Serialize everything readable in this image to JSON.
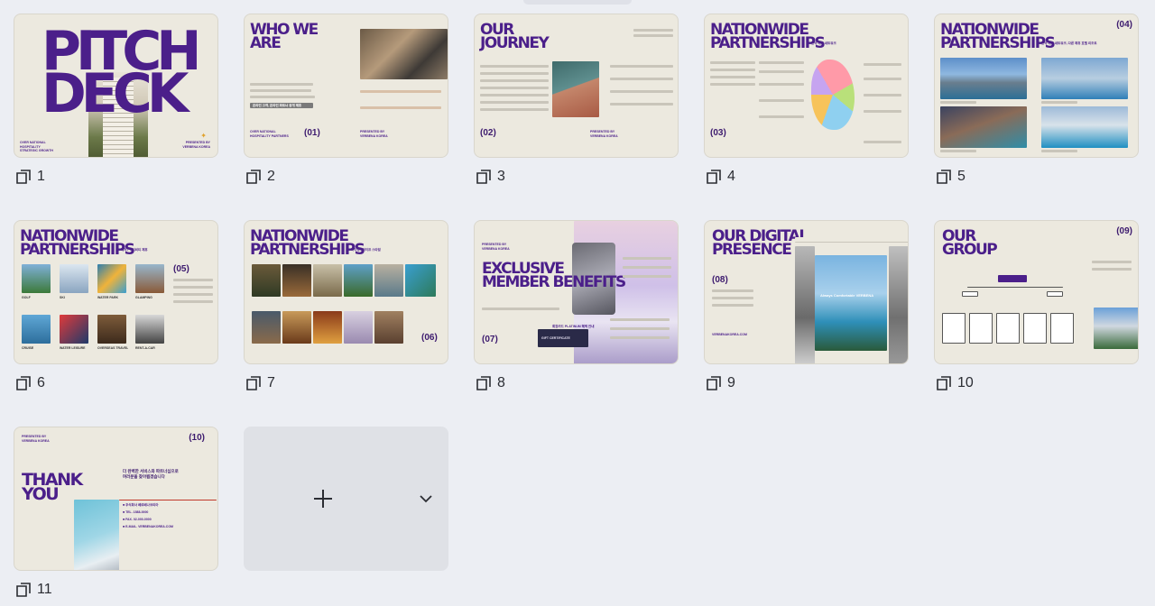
{
  "colors": {
    "accent": "#4b1f8a",
    "slide_bg": "#ece9df",
    "canvas_bg": "#eceef3"
  },
  "slide_icon": "pages-stack-icon",
  "slides": [
    {
      "number": "1",
      "title": "PITCH\nDECK",
      "left_note": "OVER NATIONAL\nHOSPITALITY\nSTRATEGIC GROWTH",
      "right_note": "PRESENTED BY\nVERBENA KOREA"
    },
    {
      "number": "2",
      "title": "WHO WE\nARE",
      "page": "(01)",
      "left_note": "OVER NATIONAL\nHOSPITALITY PARTNERS",
      "right_note": "PRESENTED BY\nVERBENA KOREA",
      "pill": "온라인 고객, 온라인 파트너 중개 제휴"
    },
    {
      "number": "3",
      "title": "OUR\nJOURNEY",
      "page": "(02)",
      "right_note": "PRESENTED BY\nVERBENA KOREA"
    },
    {
      "number": "4",
      "title": "NATIONWIDE\nPARTNERSHIPS",
      "page": "(03)",
      "subtitle": "전국 제휴 네트워크"
    },
    {
      "number": "5",
      "title": "NATIONWIDE\nPARTNERSHIPS",
      "page": "(04)",
      "subtitle": "전국 제휴 네트워크, 다른 제휴 호텔 리조트"
    },
    {
      "number": "6",
      "title": "NATIONWIDE\nPARTNERSHIPS",
      "page": "(05)",
      "subtitle": "레저 / 액티비티 제휴",
      "labels": [
        "GOLF",
        "SKI",
        "WATER PARK",
        "GLAMPING",
        "CRUISE",
        "WATER LEISURE",
        "OVERSEAS TRAVEL",
        "RENT-A-CAR"
      ]
    },
    {
      "number": "7",
      "title": "NATIONWIDE\nPARTNERSHIPS",
      "page": "(06)",
      "subtitle": "다이닝 / 라이프 스타일"
    },
    {
      "number": "8",
      "title": "EXCLUSIVE\nMEMBER BENEFITS",
      "page": "(07)",
      "top_note": "PRESENTED BY\nVERBENA KOREA",
      "card_label": "GIFT CERTIFICATE",
      "caption": "회원카드 PLATINUM 혜택 안내"
    },
    {
      "number": "9",
      "title": "OUR DIGITAL\nPRESENCE",
      "page": "(08)",
      "url": "VERBENAKOREA.COM",
      "hero_text": "Always Comfortable VERBENA"
    },
    {
      "number": "10",
      "title": "OUR\nGROUP",
      "page": "(09)"
    },
    {
      "number": "11",
      "title": "THANK\nYOU",
      "page": "(10)",
      "top_note": "PRESENTED BY\nVERBENA KOREA",
      "headline": "더 완벽한 서비스와 파트너십으로\n여러분을 찾아뵙겠습니다",
      "contacts": [
        "■ 주식회사 베르베나코리아",
        "■ TEL. 1588-0000",
        "■ FAX. 02-000-0000",
        "■ E-MAIL. VERBENAKOREA.COM"
      ]
    }
  ],
  "add_tile": {
    "plus_icon": "plus-icon",
    "chevron_icon": "chevron-down-icon"
  }
}
